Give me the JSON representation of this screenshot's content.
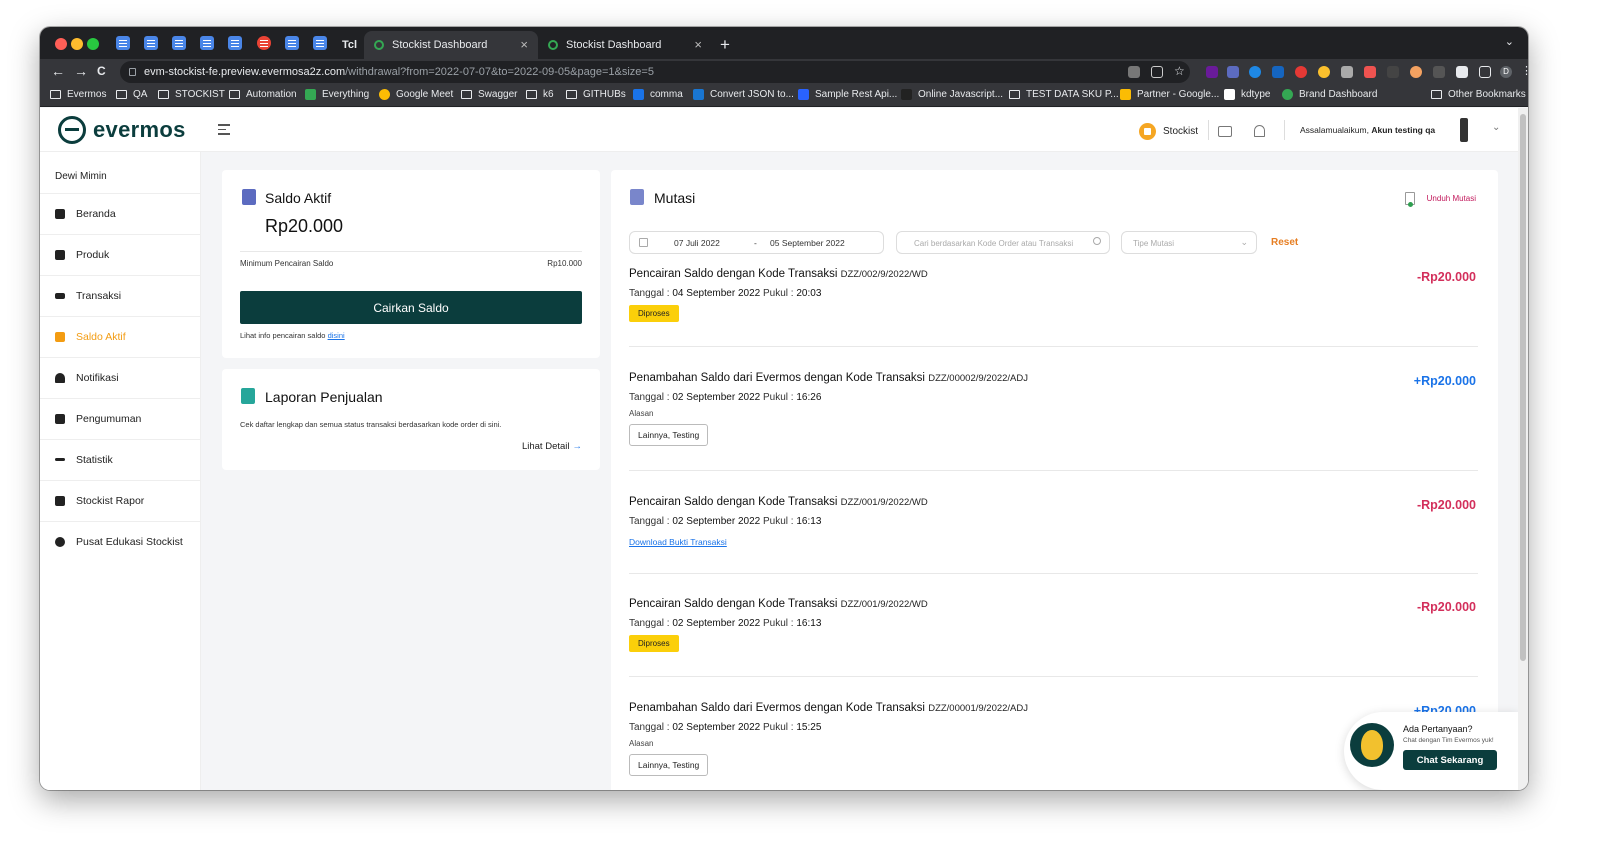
{
  "browser": {
    "tabs": [
      {
        "title": "Tcl"
      },
      {
        "title": "Stockist Dashboard"
      },
      {
        "title": "Stockist Dashboard"
      }
    ],
    "close_glyph": "×",
    "new_tab_glyph": "+",
    "menu_glyph": "⌄",
    "url_host": "evm-stockist-fe.preview.evermosa2z.com",
    "url_path": "/withdrawal?from=2022-07-07&to=2022-09-05&page=1&size=5",
    "nav": {
      "back": "←",
      "forward": "→",
      "reload": "C"
    },
    "profile_initial": "D",
    "bookmarks": [
      "Evermos",
      "QA",
      "STOCKIST",
      "Automation",
      "Everything",
      "Google Meet",
      "Swagger",
      "k6",
      "GITHUBs",
      "comma",
      "Convert JSON to...",
      "Sample Rest Api...",
      "Online Javascript...",
      "TEST DATA SKU P...",
      "Partner - Google...",
      "kdtype",
      "Brand Dashboard",
      "Other Bookmarks"
    ]
  },
  "header": {
    "logo": "evermos",
    "stockist_label": "Stockist",
    "greeting_prefix": "Assalamualaikum,",
    "greeting_name": "Akun testing qa",
    "chevron": "⌄"
  },
  "sidebar": {
    "user": "Dewi Mimin",
    "items": [
      {
        "label": "Beranda",
        "icon": "home-icon"
      },
      {
        "label": "Produk",
        "icon": "layers-icon"
      },
      {
        "label": "Transaksi",
        "icon": "arrows-icon"
      },
      {
        "label": "Saldo Aktif",
        "icon": "wallet-icon",
        "active": true
      },
      {
        "label": "Notifikasi",
        "icon": "bell-icon"
      },
      {
        "label": "Pengumuman",
        "icon": "megaphone-icon"
      },
      {
        "label": "Statistik",
        "icon": "pulse-icon"
      },
      {
        "label": "Stockist Rapor",
        "icon": "report-icon"
      },
      {
        "label": "Pusat Edukasi Stockist",
        "icon": "bulb-icon"
      }
    ]
  },
  "saldo": {
    "title": "Saldo Aktif",
    "amount": "Rp20.000",
    "min_label": "Minimum Pencairan Saldo",
    "min_value": "Rp10.000",
    "button": "Cairkan Saldo",
    "info_text": "Lihat info pencairan saldo",
    "info_link": "disini"
  },
  "laporan": {
    "title": "Laporan Penjualan",
    "desc": "Cek daftar lengkap dan semua status transaksi berdasarkan kode order di sini.",
    "link": "Lihat Detail",
    "arrow": "→"
  },
  "mutasi": {
    "title": "Mutasi",
    "download": "Unduh Mutasi",
    "date_from": "07 Juli 2022",
    "date_sep": "-",
    "date_to": "05 September 2022",
    "search_placeholder": "Cari berdasarkan Kode Order atau Transaksi",
    "type_placeholder": "Tipe Mutasi",
    "reset": "Reset",
    "tanggal_label": "Tanggal :",
    "pukul_label": "Pukul :",
    "items": [
      {
        "title": "Pencairan Saldo dengan Kode Transaksi",
        "code": "DZZ/002/9/2022/WD",
        "date": "04 September 2022",
        "time": "20:03",
        "amount": "-Rp20.000",
        "badge": "Diproses"
      },
      {
        "title": "Penambahan Saldo dari Evermos dengan Kode Transaksi",
        "code": "DZZ/00002/9/2022/ADJ",
        "date": "02 September 2022",
        "time": "16:26",
        "amount": "+Rp20.000",
        "alasan": "Alasan",
        "chip": "Lainnya, Testing"
      },
      {
        "title": "Pencairan Saldo dengan Kode Transaksi",
        "code": "DZZ/001/9/2022/WD",
        "date": "02 September 2022",
        "time": "16:13",
        "amount": "-Rp20.000",
        "link": "Download Bukti Transaksi"
      },
      {
        "title": "Pencairan Saldo dengan Kode Transaksi",
        "code": "DZZ/001/9/2022/WD",
        "date": "02 September 2022",
        "time": "16:13",
        "amount": "-Rp20.000",
        "badge": "Diproses"
      },
      {
        "title": "Penambahan Saldo dari Evermos dengan Kode Transaksi",
        "code": "DZZ/00001/9/2022/ADJ",
        "date": "02 September 2022",
        "time": "15:25",
        "amount": "+Rp20.000",
        "alasan": "Alasan",
        "chip": "Lainnya, Testing"
      }
    ]
  },
  "chat_widget": {
    "question": "Ada Pertanyaan?",
    "sub": "Chat dengan Tim Evermos yuk!",
    "button": "Chat Sekarang"
  },
  "colors": {
    "brand": "#0b3d3d",
    "active": "#f39c12",
    "negative": "#d32f5b",
    "positive": "#1a73e8",
    "badge": "#fbcf0a"
  }
}
